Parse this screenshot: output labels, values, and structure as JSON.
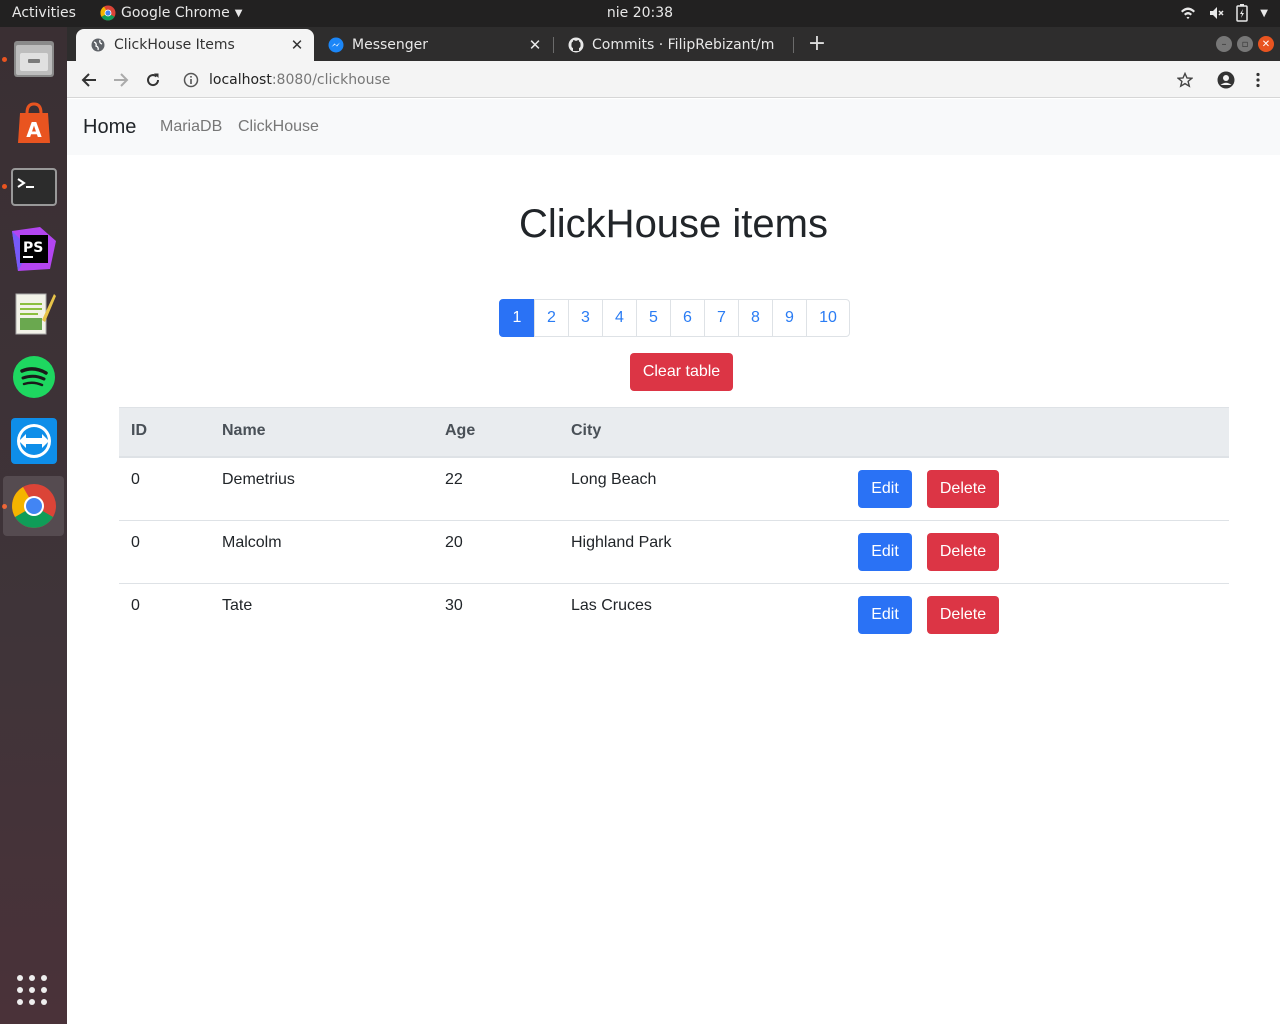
{
  "system_bar": {
    "activities": "Activities",
    "app_name": "Google Chrome",
    "clock": "nie 20:38"
  },
  "dock": {
    "items": [
      "files",
      "software-center",
      "terminal",
      "phpstorm",
      "text-editor",
      "spotify",
      "teamviewer",
      "chrome"
    ]
  },
  "browser": {
    "tabs": [
      {
        "title": "ClickHouse Items",
        "active": true
      },
      {
        "title": "Messenger",
        "active": false
      },
      {
        "title": "Commits · FilipRebizant/m",
        "active": false
      }
    ],
    "url_host": "localhost",
    "url_path": ":8080/clickhouse"
  },
  "navbar": {
    "brand": "Home",
    "links": [
      "MariaDB",
      "ClickHouse"
    ]
  },
  "main": {
    "title": "ClickHouse items",
    "pagination": [
      "1",
      "2",
      "3",
      "4",
      "5",
      "6",
      "7",
      "8",
      "9",
      "10"
    ],
    "active_page": "1",
    "clear_button": "Clear table",
    "table": {
      "headers": [
        "ID",
        "Name",
        "Age",
        "City"
      ],
      "rows": [
        {
          "id": "0",
          "name": "Demetrius",
          "age": "22",
          "city": "Long Beach"
        },
        {
          "id": "0",
          "name": "Malcolm",
          "age": "20",
          "city": "Highland Park"
        },
        {
          "id": "0",
          "name": "Tate",
          "age": "30",
          "city": "Las Cruces"
        }
      ],
      "edit_label": "Edit",
      "delete_label": "Delete"
    }
  },
  "colors": {
    "primary": "#2a72f5",
    "danger": "#dc3545",
    "navbar_bg": "#f8f9fa",
    "table_head_bg": "#e9ecef",
    "ubuntu_orange": "#e95420"
  }
}
